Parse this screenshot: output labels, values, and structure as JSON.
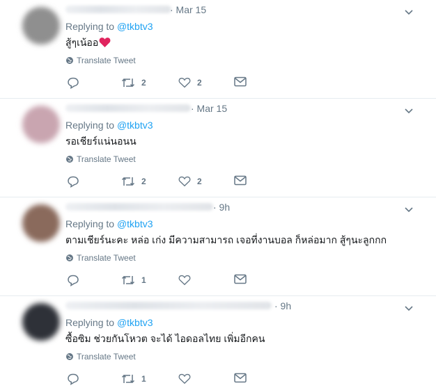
{
  "replying_prefix": "Replying to",
  "translate_label": "Translate Tweet",
  "tweets": [
    {
      "time": "· Mar 15",
      "mention": "@tkbtv3",
      "text": "สู้ๆเน้ออ",
      "emoji": "red-heart-icon",
      "retweets": "2",
      "likes": "2",
      "avatar_color": "#8f8f8f"
    },
    {
      "time": "· Mar 15",
      "mention": "@tkbtv3",
      "text": "รอเชียร์แน่นอนน",
      "retweets": "2",
      "likes": "2",
      "avatar_color": "#c9a5b0"
    },
    {
      "time": "· 9h",
      "mention": "@tkbtv3",
      "text": "ตามเชียร์นะคะ หล่อ เก่ง มีความสามารถ เจอที่งานบอล ก็หล่อมาก สู้ๆนะลูกกก",
      "retweets": "1",
      "likes": "",
      "avatar_color": "#8a6a5c"
    },
    {
      "time": "· 9h",
      "mention": "@tkbtv3",
      "text": "ซื้อซิม ช่วยกันโหวต จะได้ ไอดอลไทย เพิ่มอีกคน",
      "retweets": "1",
      "likes": "",
      "avatar_color": "#2e3138"
    }
  ],
  "colors": {
    "link": "#1da1f2",
    "secondary_text": "#657786",
    "heart": "#e0245e"
  }
}
